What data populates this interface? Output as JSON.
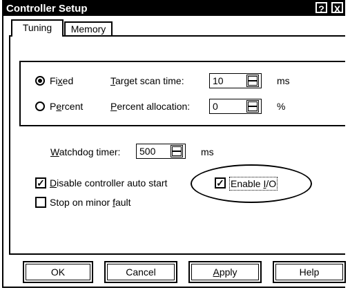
{
  "window": {
    "title": "Controller Setup",
    "help_glyph": "?",
    "close_glyph": "X"
  },
  "tabs": [
    {
      "label": "Tuning"
    },
    {
      "label": "Memory"
    }
  ],
  "scan": {
    "fixed_pre": "Fi",
    "fixed_u": "x",
    "fixed_post": "ed",
    "percent_pre": "P",
    "percent_u": "e",
    "percent_post": "rcent",
    "target_u": "T",
    "target_post": "arget scan time:",
    "target_value": "10",
    "target_unit": "ms",
    "alloc_u": "P",
    "alloc_post": "ercent allocation:",
    "alloc_value": "0",
    "alloc_unit": "%"
  },
  "watchdog": {
    "pre": "",
    "u": "W",
    "post": "atchdog timer:",
    "value": "500",
    "unit": "ms"
  },
  "options": {
    "disable_u": "D",
    "disable_post": "isable controller auto start",
    "disable_checked": true,
    "stop_pre": "Stop on minor ",
    "stop_u": "f",
    "stop_post": "ault",
    "stop_checked": false,
    "enable_pre": "Enable ",
    "enable_u": "I",
    "enable_post": "/O",
    "enable_checked": true
  },
  "buttons": {
    "ok": "OK",
    "cancel": "Cancel",
    "apply_u": "A",
    "apply_post": "pply",
    "help": "Help"
  },
  "check_glyph": "✓",
  "icons": [
    "help-icon",
    "close-icon",
    "spin-up-icon",
    "spin-down-icon"
  ]
}
